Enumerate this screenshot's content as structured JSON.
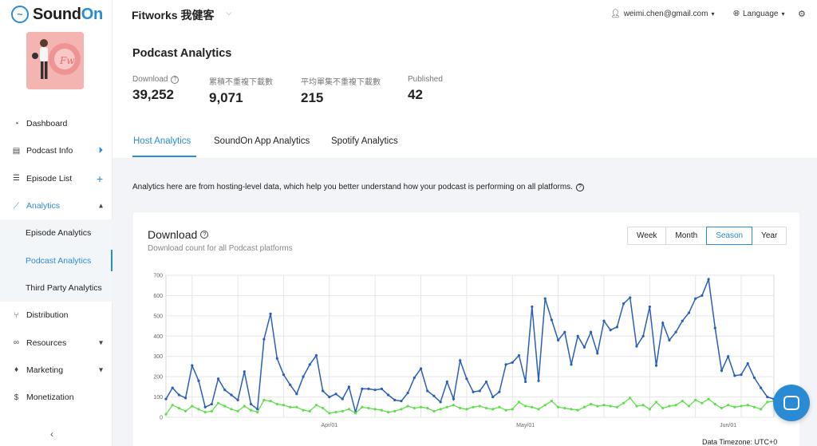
{
  "brand": {
    "name_part1": "Sound",
    "name_part2": "On"
  },
  "sidebar": {
    "items": [
      {
        "label": "Dashboard",
        "icon": "dashboard-icon"
      },
      {
        "label": "Podcast Info",
        "icon": "document-icon",
        "trail_icon": "play-circle-icon"
      },
      {
        "label": "Episode List",
        "icon": "list-icon",
        "trail_icon": "plus-icon"
      },
      {
        "label": "Analytics",
        "icon": "line-chart-icon",
        "trail_icon": "chevron-up-icon"
      }
    ],
    "sub_items": [
      {
        "label": "Episode Analytics"
      },
      {
        "label": "Podcast Analytics"
      },
      {
        "label": "Third Party Analytics"
      }
    ],
    "items_after": [
      {
        "label": "Distribution",
        "icon": "distribution-icon"
      },
      {
        "label": "Resources",
        "icon": "link-icon",
        "trail_icon": "chevron-down-icon"
      },
      {
        "label": "Marketing",
        "icon": "marketing-icon",
        "trail_icon": "chevron-down-icon"
      },
      {
        "label": "Monetization",
        "icon": "dollar-icon"
      }
    ]
  },
  "header": {
    "show_title": "Fitworks 我健客",
    "account_email": "weimi.chen@gmail.com",
    "language_label": "Language"
  },
  "page": {
    "title": "Podcast Analytics",
    "stats": [
      {
        "label": "Download",
        "value": "39,252"
      },
      {
        "label": "累積不重複下載數",
        "value": "9,071"
      },
      {
        "label": "平均單集不重複下載數",
        "value": "215"
      },
      {
        "label": "Published",
        "value": "42"
      }
    ],
    "tabs": [
      "Host Analytics",
      "SoundOn App Analytics",
      "Spotify Analytics"
    ],
    "info_text": "Analytics here are from hosting-level data, which help you better understand how your podcast is performing on all platforms."
  },
  "card": {
    "title": "Download",
    "subtitle": "Download count for all Podcast platforms",
    "periods": [
      "Week",
      "Month",
      "Season",
      "Year"
    ],
    "selected_period": "Season",
    "timezone": "Data Timezone: UTC+0"
  },
  "colors": {
    "accent": "#2a8bd4",
    "series_total": "#2a5fb8",
    "series_unique": "#5ee04a"
  },
  "chart_data": {
    "type": "line",
    "ylim": [
      0,
      700
    ],
    "yticks": [
      0,
      100,
      200,
      300,
      400,
      500,
      600,
      700
    ],
    "xtick_labels": [
      {
        "index": 25,
        "label": "Apr/01"
      },
      {
        "index": 55,
        "label": "May/01"
      },
      {
        "index": 86,
        "label": "Jun/01"
      }
    ],
    "series": [
      {
        "values": [
          90,
          145,
          110,
          95,
          255,
          180,
          50,
          65,
          190,
          135,
          110,
          85,
          225,
          65,
          40,
          385,
          510,
          290,
          210,
          160,
          115,
          200,
          260,
          305,
          130,
          100,
          115,
          90,
          150,
          25,
          140,
          140,
          135,
          140,
          110,
          85,
          80,
          120,
          195,
          240,
          130,
          105,
          75,
          175,
          90,
          280,
          190,
          125,
          130,
          175,
          100,
          125,
          260,
          270,
          305,
          175,
          545,
          180,
          585,
          480,
          380,
          420,
          260,
          400,
          345,
          420,
          315,
          475,
          430,
          445,
          560,
          590,
          350,
          400,
          545,
          255,
          465,
          380,
          420,
          475,
          515,
          585,
          600,
          680,
          440,
          230,
          300,
          205,
          210,
          265,
          195,
          145,
          100,
          90
        ]
      },
      {
        "values": [
          15,
          60,
          45,
          30,
          55,
          40,
          25,
          30,
          70,
          55,
          40,
          30,
          55,
          35,
          25,
          85,
          80,
          65,
          60,
          50,
          50,
          35,
          30,
          60,
          45,
          20,
          25,
          30,
          40,
          20,
          50,
          45,
          40,
          35,
          25,
          30,
          40,
          55,
          45,
          50,
          45,
          30,
          40,
          50,
          60,
          45,
          40,
          50,
          55,
          45,
          40,
          50,
          35,
          40,
          75,
          55,
          50,
          40,
          60,
          80,
          50,
          45,
          40,
          35,
          50,
          65,
          55,
          60,
          55,
          50,
          70,
          95,
          55,
          60,
          40,
          75,
          45,
          55,
          60,
          80,
          55,
          85,
          70,
          90,
          65,
          45,
          60,
          50,
          55,
          60,
          50,
          40,
          75,
          80
        ]
      }
    ]
  }
}
